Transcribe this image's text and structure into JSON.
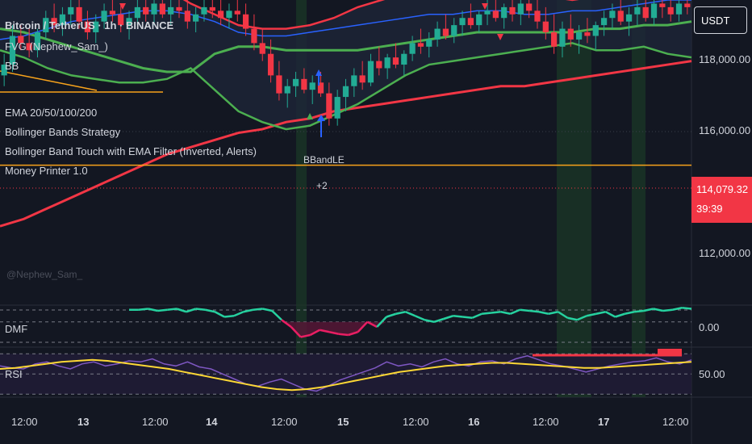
{
  "header": {
    "symbol_title": "Bitcoin / TetherUS · 1h · BINANCE",
    "currency": "USDT"
  },
  "indicators": [
    "FVG (Nephew_Sam_)",
    "BB",
    "EMA 20/50/100/200",
    "Bollinger Bands Strategy",
    "Bollinger Band Touch with EMA Filter (Inverted, Alerts)",
    "Money Printer 1.0"
  ],
  "watermark": "@Nephew_Sam_",
  "signal_labels": {
    "entry": "BBandLE",
    "count": "+2"
  },
  "last_price": {
    "value": "114,079.32",
    "countdown": "39:39"
  },
  "price_axis": [
    "118,000.00",
    "116,000.00",
    "112,000.00"
  ],
  "panes": {
    "dmf": {
      "label": "DMF",
      "axis_value": "0.00"
    },
    "rsi": {
      "label": "RSI",
      "axis_value": "50.00"
    }
  },
  "time_axis": [
    "12:00",
    "13",
    "12:00",
    "14",
    "12:00",
    "15",
    "12:00",
    "16",
    "12:00",
    "17",
    "12:00"
  ],
  "colors": {
    "background": "#131722",
    "bull": "#22ab94",
    "bear": "#f23645",
    "bb_upper": "#f23645",
    "bb_basis": "#4caf50",
    "bb_lower": "#4caf50",
    "ema_fast": "#2962ff",
    "ema_slow": "#f23645",
    "level_line": "#f7a21b",
    "rsi": "#7e57c2",
    "rsi_ma": "#fdd835",
    "dmf_pos": "#26d19f",
    "dmf_neg": "#e91e63"
  },
  "chart_data": {
    "type": "candlestick",
    "ylim": [
      110800,
      119300
    ],
    "candle_ohlc": [
      [
        117200,
        117800,
        116900,
        117500
      ],
      [
        117500,
        118600,
        117300,
        118300
      ],
      [
        118300,
        118600,
        117900,
        118100
      ],
      [
        118100,
        118500,
        117700,
        117900
      ],
      [
        117900,
        118500,
        117700,
        118400
      ],
      [
        118400,
        119000,
        118200,
        118800
      ],
      [
        118800,
        119200,
        118400,
        118600
      ],
      [
        118600,
        119100,
        118300,
        118900
      ],
      [
        118900,
        119300,
        118600,
        119100
      ],
      [
        119100,
        119300,
        118500,
        118700
      ],
      [
        118700,
        119000,
        118200,
        118400
      ],
      [
        118400,
        118900,
        118100,
        118700
      ],
      [
        118700,
        119200,
        118500,
        119000
      ],
      [
        119000,
        119300,
        118700,
        118900
      ],
      [
        118900,
        119200,
        118400,
        118600
      ],
      [
        118600,
        119000,
        118200,
        118800
      ],
      [
        118800,
        119300,
        118600,
        119100
      ],
      [
        119100,
        119300,
        118700,
        118900
      ],
      [
        118900,
        119300,
        118600,
        119200
      ],
      [
        119200,
        119300,
        118800,
        118900
      ],
      [
        118900,
        119300,
        118600,
        119100
      ],
      [
        119100,
        119300,
        118800,
        119000
      ],
      [
        119000,
        119300,
        118500,
        118700
      ],
      [
        118700,
        119100,
        118400,
        118900
      ],
      [
        118900,
        119300,
        118700,
        119100
      ],
      [
        119100,
        119300,
        118800,
        119000
      ],
      [
        119000,
        119300,
        118600,
        118800
      ],
      [
        118800,
        119200,
        118500,
        119000
      ],
      [
        119000,
        119300,
        118700,
        118900
      ],
      [
        118900,
        119200,
        118300,
        118500
      ],
      [
        118500,
        118900,
        117900,
        118100
      ],
      [
        118100,
        118500,
        117600,
        117800
      ],
      [
        117800,
        118200,
        117000,
        117200
      ],
      [
        117200,
        117600,
        116500,
        116700
      ],
      [
        116700,
        117100,
        116300,
        116900
      ],
      [
        116900,
        117300,
        116600,
        117100
      ],
      [
        117100,
        117400,
        116700,
        116800
      ],
      [
        116800,
        117200,
        116400,
        117000
      ],
      [
        117000,
        117300,
        116600,
        116700
      ],
      [
        116700,
        117000,
        115800,
        116000
      ],
      [
        116000,
        116800,
        115800,
        116600
      ],
      [
        116600,
        117100,
        116200,
        116900
      ],
      [
        116900,
        117400,
        116600,
        117200
      ],
      [
        117200,
        117600,
        116800,
        117000
      ],
      [
        117000,
        117800,
        116900,
        117600
      ],
      [
        117600,
        118000,
        117200,
        117400
      ],
      [
        117400,
        117800,
        117100,
        117700
      ],
      [
        117700,
        118100,
        117400,
        117500
      ],
      [
        117500,
        117900,
        117200,
        117800
      ],
      [
        117800,
        118300,
        117600,
        118100
      ],
      [
        118100,
        118500,
        117800,
        118000
      ],
      [
        118000,
        118400,
        117700,
        118200
      ],
      [
        118200,
        118700,
        118000,
        118500
      ],
      [
        118500,
        118900,
        118200,
        118300
      ],
      [
        118300,
        118800,
        118100,
        118600
      ],
      [
        118600,
        119000,
        118300,
        118800
      ],
      [
        118800,
        119200,
        118500,
        118600
      ],
      [
        118600,
        119000,
        118400,
        118900
      ],
      [
        118900,
        119300,
        118600,
        119000
      ],
      [
        119000,
        119300,
        118700,
        118800
      ],
      [
        118800,
        119200,
        118500,
        119100
      ],
      [
        119100,
        119300,
        118700,
        118900
      ],
      [
        118900,
        119300,
        118600,
        119200
      ],
      [
        119200,
        119300,
        118800,
        119000
      ],
      [
        119000,
        119300,
        118500,
        118700
      ],
      [
        118700,
        119100,
        118200,
        118400
      ],
      [
        118400,
        118900,
        117800,
        118000
      ],
      [
        118000,
        118700,
        117700,
        118500
      ],
      [
        118500,
        118900,
        118000,
        118200
      ],
      [
        118200,
        118600,
        117800,
        118400
      ],
      [
        118400,
        118800,
        118100,
        118300
      ],
      [
        118300,
        118700,
        117900,
        118600
      ],
      [
        118600,
        119000,
        118300,
        118800
      ],
      [
        118800,
        119200,
        118500,
        119000
      ],
      [
        119000,
        119300,
        118600,
        118700
      ],
      [
        118700,
        119100,
        118300,
        118900
      ],
      [
        118900,
        119300,
        118600,
        119100
      ],
      [
        119100,
        119300,
        118700,
        118800
      ],
      [
        118800,
        119300,
        118600,
        119200
      ],
      [
        119200,
        119300,
        118800,
        119100
      ],
      [
        119100,
        119300,
        118700,
        118900
      ],
      [
        118900,
        119300,
        118700,
        119200
      ],
      [
        119200,
        119300,
        118900,
        119100
      ]
    ],
    "series": [
      {
        "name": "BB upper",
        "values": [
          119600,
          119700,
          119900,
          119900,
          119900,
          119900,
          119800,
          119600,
          119200,
          118900,
          118600,
          118500,
          118500,
          118600,
          118800,
          119100,
          119300,
          119500,
          119700,
          119800,
          119800,
          119700,
          119600,
          119400,
          119300,
          119400,
          119500,
          119600,
          119700,
          119700
        ]
      },
      {
        "name": "BB lower",
        "values": [
          117900,
          117700,
          117400,
          117200,
          117100,
          117000,
          117000,
          117100,
          117400,
          116800,
          116200,
          115900,
          115700,
          115800,
          116100,
          116400,
          116800,
          117200,
          117500,
          117600,
          117700,
          117800,
          117900,
          118000,
          118100,
          117900,
          117900,
          118000,
          117800,
          117700
        ]
      },
      {
        "name": "BB basis",
        "values": [
          118500,
          118400,
          118200,
          118000,
          117800,
          117600,
          117400,
          117300,
          117300,
          117800,
          118000,
          118000,
          117900,
          117900,
          117900,
          117900,
          118000,
          118100,
          118200,
          118300,
          118400,
          118400,
          118400,
          118400,
          118400,
          118500,
          118500,
          118600,
          118600,
          118700
        ]
      },
      {
        "name": "EMA fast",
        "values": [
          118200,
          118300,
          118500,
          118700,
          118800,
          118900,
          119000,
          119000,
          118900,
          118700,
          118400,
          118300,
          118300,
          118400,
          118500,
          118600,
          118700,
          118800,
          118900,
          118900,
          119000,
          119000,
          118900,
          118900,
          119000,
          119000,
          119100,
          119200,
          119300,
          119300
        ]
      },
      {
        "name": "EMA slow",
        "values": [
          113000,
          113200,
          113500,
          113800,
          114100,
          114400,
          114700,
          115000,
          115200,
          115400,
          115600,
          115700,
          115900,
          116000,
          116200,
          116300,
          116400,
          116500,
          116600,
          116700,
          116800,
          116900,
          116900,
          117000,
          117100,
          117200,
          117300,
          117400,
          117500,
          117600
        ]
      }
    ],
    "horizontal_level": 114700,
    "dmf_range": [
      -0.25,
      0.15
    ],
    "dmf_values": [
      0.12,
      0.12,
      0.13,
      0.11,
      0.12,
      0.13,
      0.1,
      0.13,
      0.12,
      0.1,
      0.05,
      0.06,
      0.1,
      0.12,
      0.13,
      0.11,
      0.02,
      -0.05,
      -0.15,
      -0.13,
      -0.08,
      -0.1,
      -0.12,
      -0.13,
      -0.1,
      0.0,
      -0.05,
      0.05,
      0.08,
      0.1,
      0.06,
      0.02,
      0.0,
      0.03,
      0.06,
      0.05,
      0.04,
      0.08,
      0.09,
      0.1,
      0.08,
      0.12,
      0.11,
      0.1,
      0.08,
      0.1,
      0.04,
      0.02,
      0.06,
      0.08,
      0.1,
      0.05,
      0.08,
      0.1,
      0.11,
      0.13,
      0.11,
      0.12,
      0.14,
      0.13
    ],
    "rsi_range": [
      27,
      75
    ],
    "rsi_values": [
      58,
      56,
      55,
      60,
      62,
      58,
      55,
      60,
      62,
      58,
      60,
      63,
      62,
      65,
      60,
      58,
      62,
      57,
      55,
      50,
      45,
      40,
      38,
      42,
      45,
      40,
      35,
      33,
      38,
      44,
      48,
      52,
      56,
      62,
      58,
      60,
      57,
      62,
      65,
      60,
      58,
      62,
      63,
      60,
      65,
      68,
      64,
      60,
      58,
      55,
      52,
      55,
      58,
      60,
      62,
      63,
      66,
      62,
      60,
      64
    ],
    "rsi_ma_values": [
      55,
      56,
      58,
      60,
      62,
      63,
      64,
      63,
      61,
      59,
      57,
      55,
      52,
      49,
      46,
      43,
      40,
      37,
      35,
      34,
      35,
      37,
      40,
      43,
      46,
      49,
      52,
      54,
      56,
      58,
      59,
      60,
      61,
      61,
      60,
      59,
      58,
      57,
      56,
      56,
      57,
      58,
      59,
      60,
      61,
      62
    ],
    "x_tick_labels": [
      "12:00",
      "13",
      "12:00",
      "14",
      "12:00",
      "15",
      "12:00",
      "16",
      "12:00",
      "17",
      "12:00"
    ],
    "y_tick_labels": [
      "118,000.00",
      "116,000.00",
      "114,079.32",
      "112,000.00"
    ]
  }
}
